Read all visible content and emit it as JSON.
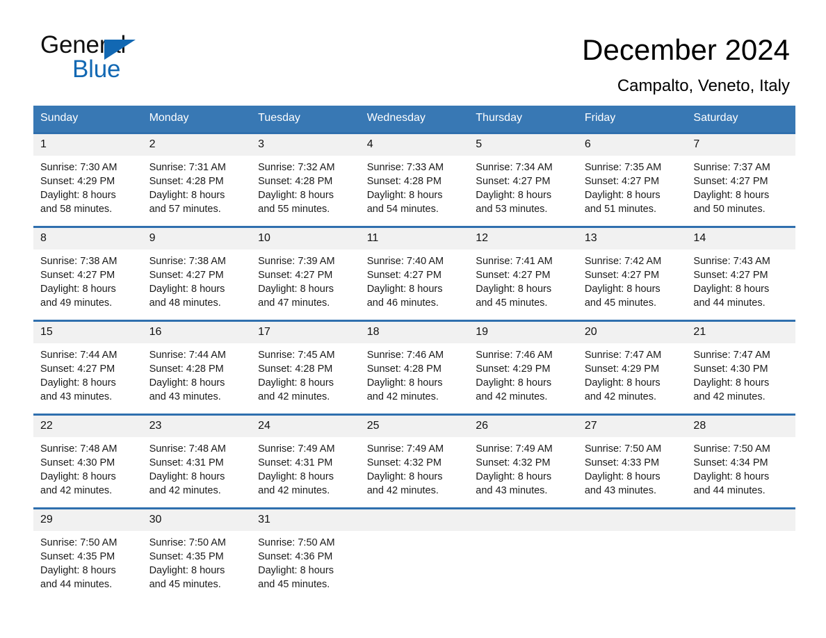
{
  "logo": {
    "word_one": "General",
    "word_two": "Blue",
    "triangle_color": "#1268b3"
  },
  "header": {
    "title": "December 2024",
    "location": "Campalto, Veneto, Italy",
    "header_bg": "#3878b4",
    "row_divider_color": "#2f6fae",
    "day_band_bg": "#f1f1f1"
  },
  "weekdays": [
    "Sunday",
    "Monday",
    "Tuesday",
    "Wednesday",
    "Thursday",
    "Friday",
    "Saturday"
  ],
  "weeks": [
    [
      {
        "day": "1",
        "sunrise": "Sunrise: 7:30 AM",
        "sunset": "Sunset: 4:29 PM",
        "daylight_line1": "Daylight: 8 hours",
        "daylight_line2": "and 58 minutes."
      },
      {
        "day": "2",
        "sunrise": "Sunrise: 7:31 AM",
        "sunset": "Sunset: 4:28 PM",
        "daylight_line1": "Daylight: 8 hours",
        "daylight_line2": "and 57 minutes."
      },
      {
        "day": "3",
        "sunrise": "Sunrise: 7:32 AM",
        "sunset": "Sunset: 4:28 PM",
        "daylight_line1": "Daylight: 8 hours",
        "daylight_line2": "and 55 minutes."
      },
      {
        "day": "4",
        "sunrise": "Sunrise: 7:33 AM",
        "sunset": "Sunset: 4:28 PM",
        "daylight_line1": "Daylight: 8 hours",
        "daylight_line2": "and 54 minutes."
      },
      {
        "day": "5",
        "sunrise": "Sunrise: 7:34 AM",
        "sunset": "Sunset: 4:27 PM",
        "daylight_line1": "Daylight: 8 hours",
        "daylight_line2": "and 53 minutes."
      },
      {
        "day": "6",
        "sunrise": "Sunrise: 7:35 AM",
        "sunset": "Sunset: 4:27 PM",
        "daylight_line1": "Daylight: 8 hours",
        "daylight_line2": "and 51 minutes."
      },
      {
        "day": "7",
        "sunrise": "Sunrise: 7:37 AM",
        "sunset": "Sunset: 4:27 PM",
        "daylight_line1": "Daylight: 8 hours",
        "daylight_line2": "and 50 minutes."
      }
    ],
    [
      {
        "day": "8",
        "sunrise": "Sunrise: 7:38 AM",
        "sunset": "Sunset: 4:27 PM",
        "daylight_line1": "Daylight: 8 hours",
        "daylight_line2": "and 49 minutes."
      },
      {
        "day": "9",
        "sunrise": "Sunrise: 7:38 AM",
        "sunset": "Sunset: 4:27 PM",
        "daylight_line1": "Daylight: 8 hours",
        "daylight_line2": "and 48 minutes."
      },
      {
        "day": "10",
        "sunrise": "Sunrise: 7:39 AM",
        "sunset": "Sunset: 4:27 PM",
        "daylight_line1": "Daylight: 8 hours",
        "daylight_line2": "and 47 minutes."
      },
      {
        "day": "11",
        "sunrise": "Sunrise: 7:40 AM",
        "sunset": "Sunset: 4:27 PM",
        "daylight_line1": "Daylight: 8 hours",
        "daylight_line2": "and 46 minutes."
      },
      {
        "day": "12",
        "sunrise": "Sunrise: 7:41 AM",
        "sunset": "Sunset: 4:27 PM",
        "daylight_line1": "Daylight: 8 hours",
        "daylight_line2": "and 45 minutes."
      },
      {
        "day": "13",
        "sunrise": "Sunrise: 7:42 AM",
        "sunset": "Sunset: 4:27 PM",
        "daylight_line1": "Daylight: 8 hours",
        "daylight_line2": "and 45 minutes."
      },
      {
        "day": "14",
        "sunrise": "Sunrise: 7:43 AM",
        "sunset": "Sunset: 4:27 PM",
        "daylight_line1": "Daylight: 8 hours",
        "daylight_line2": "and 44 minutes."
      }
    ],
    [
      {
        "day": "15",
        "sunrise": "Sunrise: 7:44 AM",
        "sunset": "Sunset: 4:27 PM",
        "daylight_line1": "Daylight: 8 hours",
        "daylight_line2": "and 43 minutes."
      },
      {
        "day": "16",
        "sunrise": "Sunrise: 7:44 AM",
        "sunset": "Sunset: 4:28 PM",
        "daylight_line1": "Daylight: 8 hours",
        "daylight_line2": "and 43 minutes."
      },
      {
        "day": "17",
        "sunrise": "Sunrise: 7:45 AM",
        "sunset": "Sunset: 4:28 PM",
        "daylight_line1": "Daylight: 8 hours",
        "daylight_line2": "and 42 minutes."
      },
      {
        "day": "18",
        "sunrise": "Sunrise: 7:46 AM",
        "sunset": "Sunset: 4:28 PM",
        "daylight_line1": "Daylight: 8 hours",
        "daylight_line2": "and 42 minutes."
      },
      {
        "day": "19",
        "sunrise": "Sunrise: 7:46 AM",
        "sunset": "Sunset: 4:29 PM",
        "daylight_line1": "Daylight: 8 hours",
        "daylight_line2": "and 42 minutes."
      },
      {
        "day": "20",
        "sunrise": "Sunrise: 7:47 AM",
        "sunset": "Sunset: 4:29 PM",
        "daylight_line1": "Daylight: 8 hours",
        "daylight_line2": "and 42 minutes."
      },
      {
        "day": "21",
        "sunrise": "Sunrise: 7:47 AM",
        "sunset": "Sunset: 4:30 PM",
        "daylight_line1": "Daylight: 8 hours",
        "daylight_line2": "and 42 minutes."
      }
    ],
    [
      {
        "day": "22",
        "sunrise": "Sunrise: 7:48 AM",
        "sunset": "Sunset: 4:30 PM",
        "daylight_line1": "Daylight: 8 hours",
        "daylight_line2": "and 42 minutes."
      },
      {
        "day": "23",
        "sunrise": "Sunrise: 7:48 AM",
        "sunset": "Sunset: 4:31 PM",
        "daylight_line1": "Daylight: 8 hours",
        "daylight_line2": "and 42 minutes."
      },
      {
        "day": "24",
        "sunrise": "Sunrise: 7:49 AM",
        "sunset": "Sunset: 4:31 PM",
        "daylight_line1": "Daylight: 8 hours",
        "daylight_line2": "and 42 minutes."
      },
      {
        "day": "25",
        "sunrise": "Sunrise: 7:49 AM",
        "sunset": "Sunset: 4:32 PM",
        "daylight_line1": "Daylight: 8 hours",
        "daylight_line2": "and 42 minutes."
      },
      {
        "day": "26",
        "sunrise": "Sunrise: 7:49 AM",
        "sunset": "Sunset: 4:32 PM",
        "daylight_line1": "Daylight: 8 hours",
        "daylight_line2": "and 43 minutes."
      },
      {
        "day": "27",
        "sunrise": "Sunrise: 7:50 AM",
        "sunset": "Sunset: 4:33 PM",
        "daylight_line1": "Daylight: 8 hours",
        "daylight_line2": "and 43 minutes."
      },
      {
        "day": "28",
        "sunrise": "Sunrise: 7:50 AM",
        "sunset": "Sunset: 4:34 PM",
        "daylight_line1": "Daylight: 8 hours",
        "daylight_line2": "and 44 minutes."
      }
    ],
    [
      {
        "day": "29",
        "sunrise": "Sunrise: 7:50 AM",
        "sunset": "Sunset: 4:35 PM",
        "daylight_line1": "Daylight: 8 hours",
        "daylight_line2": "and 44 minutes."
      },
      {
        "day": "30",
        "sunrise": "Sunrise: 7:50 AM",
        "sunset": "Sunset: 4:35 PM",
        "daylight_line1": "Daylight: 8 hours",
        "daylight_line2": "and 45 minutes."
      },
      {
        "day": "31",
        "sunrise": "Sunrise: 7:50 AM",
        "sunset": "Sunset: 4:36 PM",
        "daylight_line1": "Daylight: 8 hours",
        "daylight_line2": "and 45 minutes."
      },
      {
        "day": "",
        "sunrise": "",
        "sunset": "",
        "daylight_line1": "",
        "daylight_line2": ""
      },
      {
        "day": "",
        "sunrise": "",
        "sunset": "",
        "daylight_line1": "",
        "daylight_line2": ""
      },
      {
        "day": "",
        "sunrise": "",
        "sunset": "",
        "daylight_line1": "",
        "daylight_line2": ""
      },
      {
        "day": "",
        "sunrise": "",
        "sunset": "",
        "daylight_line1": "",
        "daylight_line2": ""
      }
    ]
  ]
}
